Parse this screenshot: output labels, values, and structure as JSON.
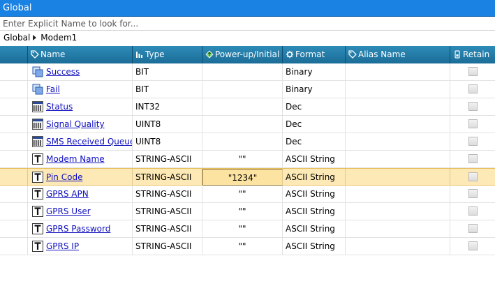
{
  "window": {
    "title": "Global"
  },
  "search": {
    "placeholder": "Enter Explicit Name to look for..."
  },
  "breadcrumb": {
    "items": [
      "Global",
      "Modem1"
    ]
  },
  "columns": {
    "name": "Name",
    "type": "Type",
    "init": "Power-up/Initial",
    "format": "Format",
    "alias": "Alias Name",
    "retain": "Retain"
  },
  "rows": [
    {
      "name": "Success",
      "type": "BIT",
      "init": "",
      "format": "Binary",
      "alias": "",
      "icon": "bit-icon",
      "selected": false
    },
    {
      "name": "Fail",
      "type": "BIT",
      "init": "",
      "format": "Binary",
      "alias": "",
      "icon": "bit-icon",
      "selected": false
    },
    {
      "name": "Status",
      "type": "INT32",
      "init": "",
      "format": "Dec",
      "alias": "",
      "icon": "integer-icon",
      "selected": false
    },
    {
      "name": "Signal Quality",
      "type": "UINT8",
      "init": "",
      "format": "Dec",
      "alias": "",
      "icon": "integer-icon",
      "selected": false
    },
    {
      "name": "SMS Received Queue",
      "type": "UINT8",
      "init": "",
      "format": "Dec",
      "alias": "",
      "icon": "integer-icon",
      "selected": false
    },
    {
      "name": "Modem Name",
      "type": "STRING-ASCII",
      "init": "\"\"",
      "format": "ASCII String",
      "alias": "",
      "icon": "string-icon",
      "selected": false
    },
    {
      "name": "Pin Code",
      "type": "STRING-ASCII",
      "init": "\"1234\"",
      "format": "ASCII String",
      "alias": "",
      "icon": "string-icon",
      "selected": true
    },
    {
      "name": "GPRS APN",
      "type": "STRING-ASCII",
      "init": "\"\"",
      "format": "ASCII String",
      "alias": "",
      "icon": "string-icon",
      "selected": false
    },
    {
      "name": "GPRS User",
      "type": "STRING-ASCII",
      "init": "\"\"",
      "format": "ASCII String",
      "alias": "",
      "icon": "string-icon",
      "selected": false
    },
    {
      "name": "GPRS Password",
      "type": "STRING-ASCII",
      "init": "\"\"",
      "format": "ASCII String",
      "alias": "",
      "icon": "string-icon",
      "selected": false
    },
    {
      "name": "GPRS IP",
      "type": "STRING-ASCII",
      "init": "\"\"",
      "format": "ASCII String",
      "alias": "",
      "icon": "string-icon",
      "selected": false
    }
  ],
  "colors": {
    "title_bar": "#1a82e2",
    "header": "#1b6d97",
    "selected_row": "#fde9b5",
    "link": "#1010c0"
  }
}
